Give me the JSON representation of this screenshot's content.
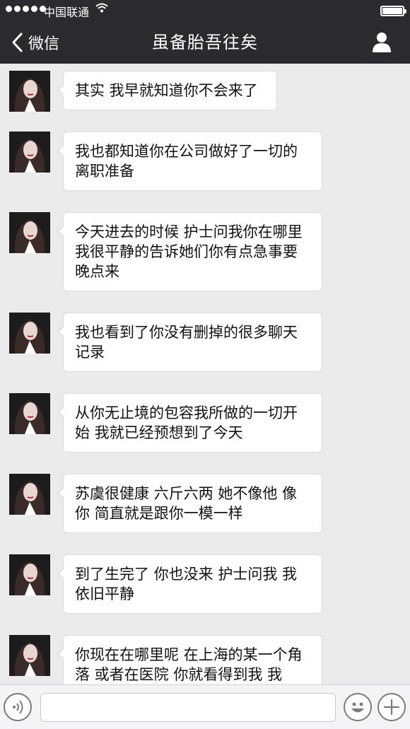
{
  "status_bar": {
    "carrier": "中国联通",
    "wifi_icon": "wifi-icon",
    "battery_icon": "battery-icon"
  },
  "nav": {
    "back_label": "微信",
    "title": "虽备胎吾往矣",
    "profile_icon": "person-icon"
  },
  "messages": [
    {
      "text": "其实 我早就知道你不会来了"
    },
    {
      "text": "我也都知道你在公司做好了一切的离职准备"
    },
    {
      "text": "今天进去的时候 护士问我你在哪里 我很平静的告诉她们你有点急事要晚点来"
    },
    {
      "text": "我也看到了你没有删掉的很多聊天记录"
    },
    {
      "text": "从你无止境的包容我所做的一切开始 我就已经预想到了今天"
    },
    {
      "text": "苏虞很健康 六斤六两 她不像他 像你 简直就是跟你一模一样"
    },
    {
      "text": "到了生完了 你也没来 护士问我 我依旧平静"
    },
    {
      "text": "你现在在哪里呢 在上海的某一个角落 或者在医院 你就看得到我 我"
    }
  ],
  "input": {
    "voice_icon": "voice-icon",
    "emoji_icon": "emoji-icon",
    "plus_icon": "plus-icon",
    "placeholder": ""
  },
  "colors": {
    "header_bg": "#2b2b2f",
    "chat_bg": "#ebebeb",
    "bubble_bg": "#ffffff"
  }
}
